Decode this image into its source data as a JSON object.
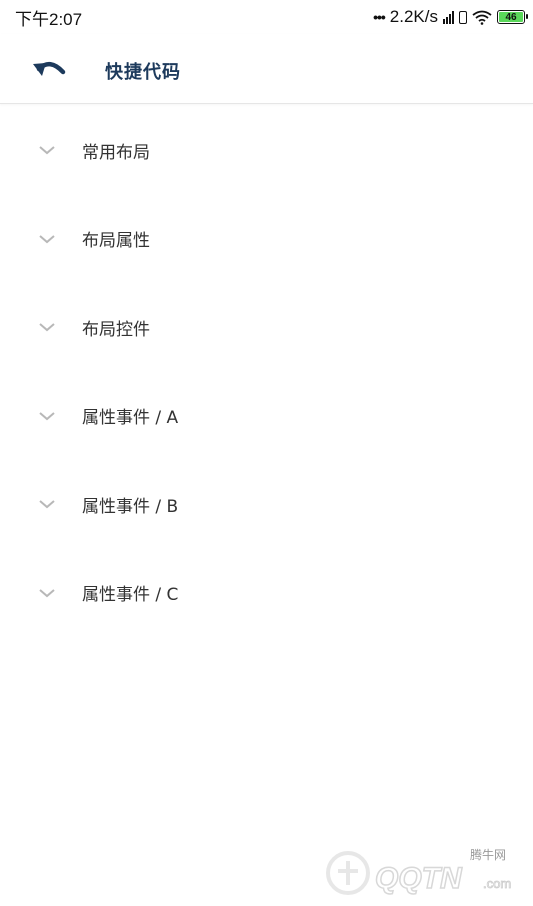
{
  "status_bar": {
    "time": "下午2:07",
    "network_speed": "2.2K/s",
    "battery_level": "46",
    "battery_color": "#5ad85a"
  },
  "app_bar": {
    "title": "快捷代码",
    "back_icon": "undo-arrow-icon"
  },
  "list": {
    "items": [
      {
        "label": "常用布局",
        "icon": "chevron-down-icon"
      },
      {
        "label": "布局属性",
        "icon": "chevron-down-icon"
      },
      {
        "label": "布局控件",
        "icon": "chevron-down-icon"
      },
      {
        "label": "属性事件 / A",
        "icon": "chevron-down-icon"
      },
      {
        "label": "属性事件 / B",
        "icon": "chevron-down-icon"
      },
      {
        "label": "属性事件 / C",
        "icon": "chevron-down-icon"
      }
    ]
  },
  "watermark": {
    "cn_text": "腾牛网",
    "en_text": "QQTN",
    "suffix": ".com"
  },
  "colors": {
    "title": "#1d3a5c",
    "chevron": "#b8b8b8",
    "label": "#333333"
  }
}
